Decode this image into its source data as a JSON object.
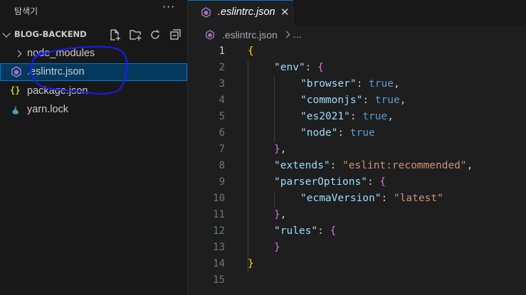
{
  "sidebar": {
    "title": "탐색기",
    "more_label": "···",
    "section_label": "BLOG-BACKEND",
    "actions": [
      "new-file",
      "new-folder",
      "refresh",
      "collapse-all"
    ],
    "items": [
      {
        "label": "node_modules",
        "kind": "folder"
      },
      {
        "label": ".eslintrc.json",
        "kind": "eslint",
        "selected": true
      },
      {
        "label": "package.json",
        "kind": "json"
      },
      {
        "label": "yarn.lock",
        "kind": "yarn"
      }
    ]
  },
  "tab": {
    "label": ".eslintrc.json",
    "close": "✕"
  },
  "breadcrumb": {
    "file": ".eslintrc.json",
    "more": "..."
  },
  "editor": {
    "active_line": 1,
    "lines": [
      {
        "n": "1",
        "code": [
          {
            "t": "{",
            "c": "br1"
          }
        ]
      },
      {
        "n": "2",
        "code": [
          {
            "t": "    ",
            "c": "p"
          },
          {
            "t": "\"env\"",
            "c": "k"
          },
          {
            "t": ": ",
            "c": "p"
          },
          {
            "t": "{",
            "c": "br2"
          }
        ]
      },
      {
        "n": "3",
        "code": [
          {
            "t": "        ",
            "c": "p"
          },
          {
            "t": "\"browser\"",
            "c": "k"
          },
          {
            "t": ": ",
            "c": "p"
          },
          {
            "t": "true",
            "c": "b"
          },
          {
            "t": ",",
            "c": "p"
          }
        ]
      },
      {
        "n": "4",
        "code": [
          {
            "t": "        ",
            "c": "p"
          },
          {
            "t": "\"commonjs\"",
            "c": "k"
          },
          {
            "t": ": ",
            "c": "p"
          },
          {
            "t": "true",
            "c": "b"
          },
          {
            "t": ",",
            "c": "p"
          }
        ]
      },
      {
        "n": "5",
        "code": [
          {
            "t": "        ",
            "c": "p"
          },
          {
            "t": "\"es2021\"",
            "c": "k"
          },
          {
            "t": ": ",
            "c": "p"
          },
          {
            "t": "true",
            "c": "b"
          },
          {
            "t": ",",
            "c": "p"
          }
        ]
      },
      {
        "n": "6",
        "code": [
          {
            "t": "        ",
            "c": "p"
          },
          {
            "t": "\"node\"",
            "c": "k"
          },
          {
            "t": ": ",
            "c": "p"
          },
          {
            "t": "true",
            "c": "b"
          }
        ]
      },
      {
        "n": "7",
        "code": [
          {
            "t": "    ",
            "c": "p"
          },
          {
            "t": "}",
            "c": "br2"
          },
          {
            "t": ",",
            "c": "p"
          }
        ]
      },
      {
        "n": "8",
        "code": [
          {
            "t": "    ",
            "c": "p"
          },
          {
            "t": "\"extends\"",
            "c": "k"
          },
          {
            "t": ": ",
            "c": "p"
          },
          {
            "t": "\"eslint:recommended\"",
            "c": "s"
          },
          {
            "t": ",",
            "c": "p"
          }
        ]
      },
      {
        "n": "9",
        "code": [
          {
            "t": "    ",
            "c": "p"
          },
          {
            "t": "\"parserOptions\"",
            "c": "k"
          },
          {
            "t": ": ",
            "c": "p"
          },
          {
            "t": "{",
            "c": "br2"
          }
        ]
      },
      {
        "n": "10",
        "code": [
          {
            "t": "        ",
            "c": "p"
          },
          {
            "t": "\"ecmaVersion\"",
            "c": "k"
          },
          {
            "t": ": ",
            "c": "p"
          },
          {
            "t": "\"latest\"",
            "c": "s"
          }
        ]
      },
      {
        "n": "11",
        "code": [
          {
            "t": "    ",
            "c": "p"
          },
          {
            "t": "}",
            "c": "br2"
          },
          {
            "t": ",",
            "c": "p"
          }
        ]
      },
      {
        "n": "12",
        "code": [
          {
            "t": "    ",
            "c": "p"
          },
          {
            "t": "\"rules\"",
            "c": "k"
          },
          {
            "t": ": ",
            "c": "p"
          },
          {
            "t": "{",
            "c": "br2"
          }
        ]
      },
      {
        "n": "13",
        "code": [
          {
            "t": "    ",
            "c": "p"
          },
          {
            "t": "}",
            "c": "br2"
          }
        ]
      },
      {
        "n": "14",
        "code": [
          {
            "t": "}",
            "c": "br1"
          }
        ]
      },
      {
        "n": "15",
        "code": []
      }
    ]
  },
  "colors": {
    "accent": "#0078d4",
    "selection": "#04395e",
    "annotation_pen": "#1a1aff",
    "eslint_icon": "#a074c4",
    "json_icon": "#cbcb41",
    "yarn_icon": "#519aba"
  }
}
